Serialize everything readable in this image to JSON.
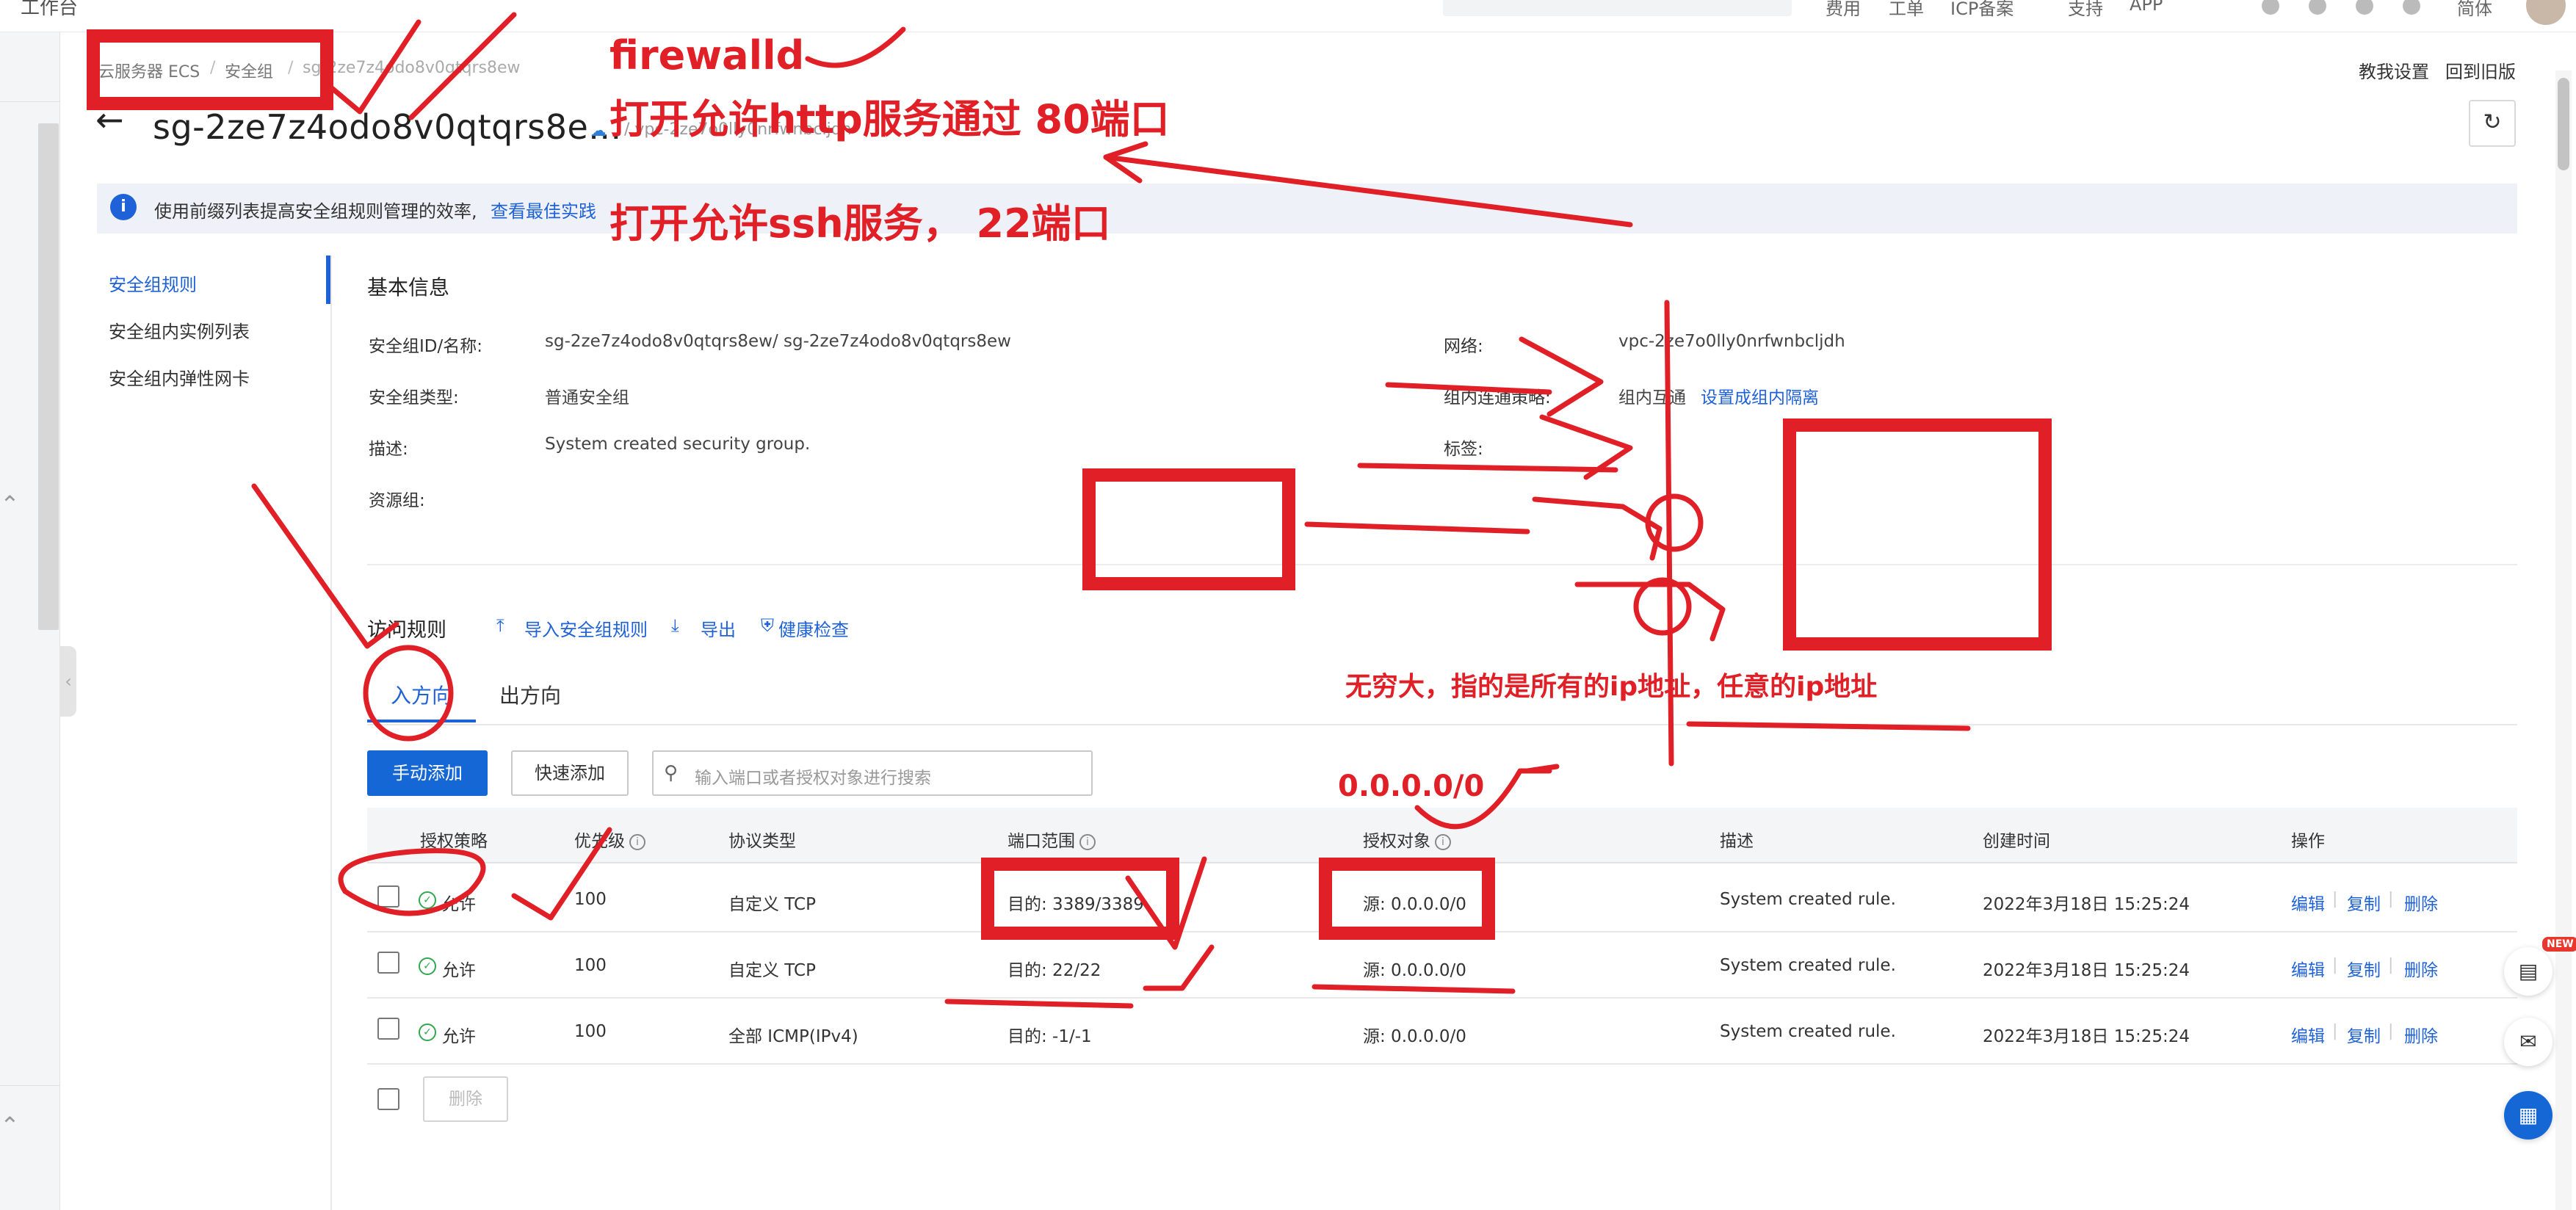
{
  "topbar": {
    "left_stub": "工作台",
    "nav_items": [
      "费用",
      "工单",
      "ICP备案",
      "支持",
      "APP"
    ],
    "user_short": "简体"
  },
  "breadcrumb": {
    "items": [
      "云服务器 ECS",
      "安全组",
      "sg-2ze7z4odo8v0qtqrs8ew"
    ]
  },
  "header": {
    "links": [
      "教我设置",
      "回到旧版"
    ],
    "title": "sg-2ze7z4odo8v0qtqrs8e...",
    "vpc": "/ vpc-2ze7o0lly0nrfwnbcljdh"
  },
  "banner": {
    "text": "使用前缀列表提高安全组规则管理的效率,",
    "link": "查看最佳实践"
  },
  "subnav": [
    {
      "label": "安全组规则",
      "active": true
    },
    {
      "label": "安全组内实例列表",
      "active": false
    },
    {
      "label": "安全组内弹性网卡",
      "active": false
    }
  ],
  "basic_info": {
    "title": "基本信息",
    "id_label": "安全组ID/名称:",
    "id_value": "sg-2ze7z4odo8v0qtqrs8ew/ sg-2ze7z4odo8v0qtqrs8ew",
    "type_label": "安全组类型:",
    "type_value": "普通安全组",
    "desc_label": "描述:",
    "desc_value": "System created security group.",
    "rg_label": "资源组:",
    "network_label": "网络:",
    "network_value": "vpc-2ze7o0lly0nrfwnbcljdh",
    "policy_label": "组内连通策略:",
    "policy_value": "组内互通",
    "policy_link": "设置成组内隔离",
    "tags_label": "标签:"
  },
  "rules": {
    "title": "访问规则",
    "import": "导入安全组规则",
    "export": "导出",
    "health": "健康检查",
    "tabs": [
      "入方向",
      "出方向"
    ],
    "btn_manual": "手动添加",
    "btn_quick": "快速添加",
    "search_placeholder": "输入端口或者授权对象进行搜索",
    "columns": [
      "授权策略",
      "优先级",
      "协议类型",
      "端口范围",
      "授权对象",
      "描述",
      "创建时间",
      "操作"
    ],
    "rows": [
      {
        "policy": "允许",
        "priority": "100",
        "protocol": "自定义 TCP",
        "port": "目的: 3389/3389",
        "source": "源: 0.0.0.0/0",
        "desc": "System created rule.",
        "time": "2022年3月18日 15:25:24"
      },
      {
        "policy": "允许",
        "priority": "100",
        "protocol": "自定义 TCP",
        "port": "目的: 22/22",
        "source": "源: 0.0.0.0/0",
        "desc": "System created rule.",
        "time": "2022年3月18日 15:25:24"
      },
      {
        "policy": "允许",
        "priority": "100",
        "protocol": "全部 ICMP(IPv4)",
        "port": "目的: -1/-1",
        "source": "源: 0.0.0.0/0",
        "desc": "System created rule.",
        "time": "2022年3月18日 15:25:24"
      }
    ],
    "actions": [
      "编辑",
      "复制",
      "删除"
    ],
    "delete_label": "删除"
  },
  "annotations": {
    "a1": "firewalld",
    "a2": "打开允许http服务通过  80端口",
    "a3": "打开允许ssh服务，  22端口",
    "a4": "无穷大，指的是所有的ip地址，任意的ip地址",
    "a5": "0.0.0.0/0"
  },
  "badges": {
    "new": "NEW"
  },
  "colors": {
    "primary": "#1667d6",
    "annotation": "#e01f26",
    "success": "#2fa84f"
  }
}
